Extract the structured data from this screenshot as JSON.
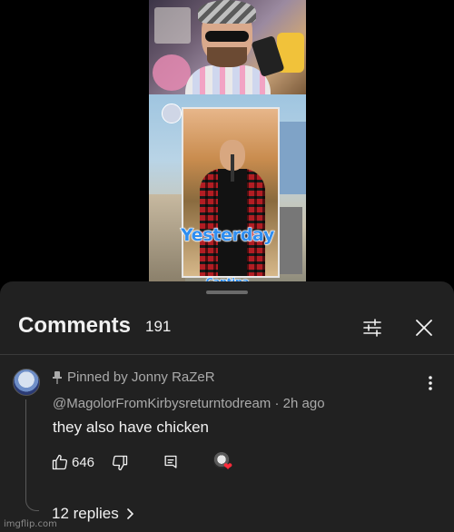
{
  "video": {
    "overlay_title": "Yesterday",
    "overlay_subtitle": "Cantina"
  },
  "comments_panel": {
    "title": "Comments",
    "count": "191",
    "filter_icon": "sliders-icon",
    "close_icon": "close-icon"
  },
  "comment": {
    "pinned_label": "Pinned by Jonny RaZeR",
    "author": "@MagolorFromKirbysreturntodream",
    "time_ago": "2h ago",
    "text": "they also have chicken",
    "likes": "646",
    "replies_label": "12 replies",
    "creator_heart": true
  },
  "watermark": "imgflip.com",
  "colors": {
    "panel_bg": "#212121",
    "primary_text": "#f1f1f1",
    "secondary_text": "#aaaaaa",
    "heart_red": "#ff2b3a",
    "overlay_blue": "#2f8ef0"
  }
}
